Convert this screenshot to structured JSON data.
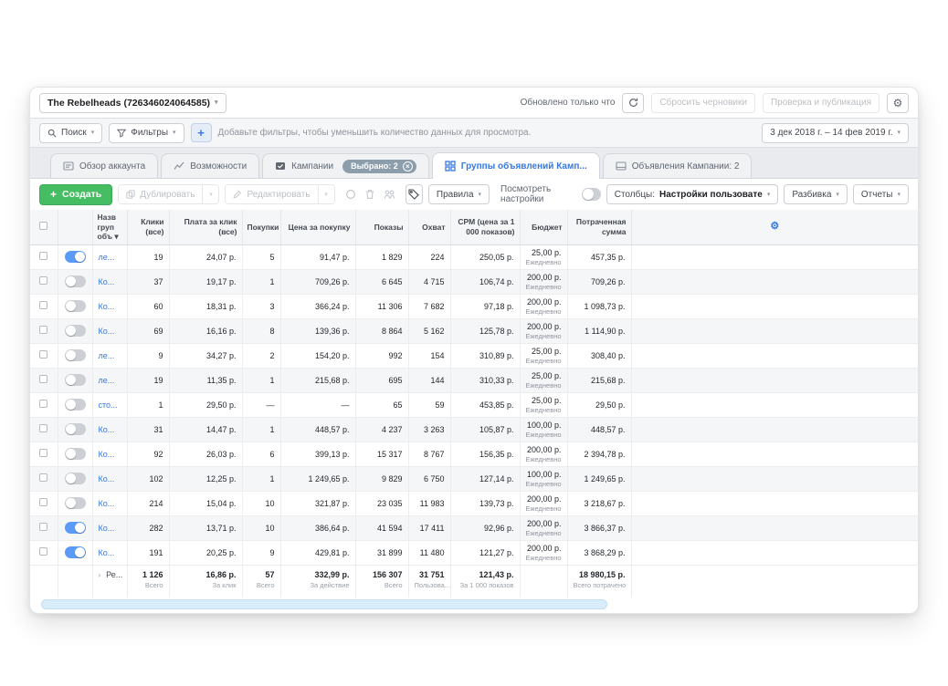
{
  "topbar": {
    "account": "The Rebelheads (726346024064585)",
    "updated": "Обновлено только что",
    "discard_drafts": "Сбросить черновики",
    "review_publish": "Проверка и публикация"
  },
  "filterbar": {
    "search": "Поиск",
    "filters": "Фильтры",
    "placeholder": "Добавьте фильтры, чтобы уменьшить количество данных для просмотра.",
    "date_range": "3 дек 2018 г. – 14 фев 2019 г."
  },
  "tabs": [
    {
      "label": "Обзор аккаунта"
    },
    {
      "label": "Возможности"
    },
    {
      "label": "Кампании",
      "badge": "Выбрано: 2"
    },
    {
      "label": "Группы объявлений Камп..."
    },
    {
      "label": "Объявления Кампании: 2"
    }
  ],
  "toolbar": {
    "create": "Создать",
    "duplicate": "Дублировать",
    "edit": "Редактировать",
    "rules": "Правила",
    "view_settings": "Посмотреть настройки",
    "columns_prefix": "Столбцы:",
    "columns_value": "Настройки пользовате",
    "breakdown": "Разбивка",
    "reports": "Отчеты"
  },
  "table": {
    "columns": [
      "Назв груп объ ▾",
      "Клики (все)",
      "Плата за клик (все)",
      "Покупки",
      "Цена за покупку",
      "Показы",
      "Охват",
      "CPM (цена за 1 000 показов)",
      "Бюджет",
      "Потраченная сумма"
    ],
    "rows": [
      {
        "name": "ле...",
        "on": true,
        "clicks": "19",
        "cpc": "24,07 р.",
        "purchases": "5",
        "cpp": "91,47 р.",
        "impr": "1 829",
        "reach": "224",
        "cpm": "250,05 р.",
        "budget": "25,00 р.",
        "budget_note": "Ежедневно",
        "spent": "457,35 р."
      },
      {
        "name": "Ко...",
        "on": false,
        "clicks": "37",
        "cpc": "19,17 р.",
        "purchases": "1",
        "cpp": "709,26 р.",
        "impr": "6 645",
        "reach": "4 715",
        "cpm": "106,74 р.",
        "budget": "200,00 р.",
        "budget_note": "Ежедневно",
        "spent": "709,26 р."
      },
      {
        "name": "Ко...",
        "on": false,
        "clicks": "60",
        "cpc": "18,31 р.",
        "purchases": "3",
        "cpp": "366,24 р.",
        "impr": "11 306",
        "reach": "7 682",
        "cpm": "97,18 р.",
        "budget": "200,00 р.",
        "budget_note": "Ежедневно",
        "spent": "1 098,73 р."
      },
      {
        "name": "Ко...",
        "on": false,
        "clicks": "69",
        "cpc": "16,16 р.",
        "purchases": "8",
        "cpp": "139,36 р.",
        "impr": "8 864",
        "reach": "5 162",
        "cpm": "125,78 р.",
        "budget": "200,00 р.",
        "budget_note": "Ежедневно",
        "spent": "1 114,90 р."
      },
      {
        "name": "ле...",
        "on": false,
        "clicks": "9",
        "cpc": "34,27 р.",
        "purchases": "2",
        "cpp": "154,20 р.",
        "impr": "992",
        "reach": "154",
        "cpm": "310,89 р.",
        "budget": "25,00 р.",
        "budget_note": "Ежедневно",
        "spent": "308,40 р."
      },
      {
        "name": "ле...",
        "on": false,
        "clicks": "19",
        "cpc": "11,35 р.",
        "purchases": "1",
        "cpp": "215,68 р.",
        "impr": "695",
        "reach": "144",
        "cpm": "310,33 р.",
        "budget": "25,00 р.",
        "budget_note": "Ежедневно",
        "spent": "215,68 р."
      },
      {
        "name": "сто...",
        "on": false,
        "clicks": "1",
        "cpc": "29,50 р.",
        "purchases": "—",
        "cpp": "—",
        "impr": "65",
        "reach": "59",
        "cpm": "453,85 р.",
        "budget": "25,00 р.",
        "budget_note": "Ежедневно",
        "spent": "29,50 р."
      },
      {
        "name": "Ко...",
        "on": false,
        "clicks": "31",
        "cpc": "14,47 р.",
        "purchases": "1",
        "cpp": "448,57 р.",
        "impr": "4 237",
        "reach": "3 263",
        "cpm": "105,87 р.",
        "budget": "100,00 р.",
        "budget_note": "Ежедневно",
        "spent": "448,57 р."
      },
      {
        "name": "Ко...",
        "on": false,
        "clicks": "92",
        "cpc": "26,03 р.",
        "purchases": "6",
        "cpp": "399,13 р.",
        "impr": "15 317",
        "reach": "8 767",
        "cpm": "156,35 р.",
        "budget": "200,00 р.",
        "budget_note": "Ежедневно",
        "spent": "2 394,78 р."
      },
      {
        "name": "Ко...",
        "on": false,
        "clicks": "102",
        "cpc": "12,25 р.",
        "purchases": "1",
        "cpp": "1 249,65 р.",
        "impr": "9 829",
        "reach": "6 750",
        "cpm": "127,14 р.",
        "budget": "100,00 р.",
        "budget_note": "Ежедневно",
        "spent": "1 249,65 р."
      },
      {
        "name": "Ко...",
        "on": false,
        "clicks": "214",
        "cpc": "15,04 р.",
        "purchases": "10",
        "cpp": "321,87 р.",
        "impr": "23 035",
        "reach": "11 983",
        "cpm": "139,73 р.",
        "budget": "200,00 р.",
        "budget_note": "Ежедневно",
        "spent": "3 218,67 р."
      },
      {
        "name": "Ко...",
        "on": true,
        "clicks": "282",
        "cpc": "13,71 р.",
        "purchases": "10",
        "cpp": "386,64 р.",
        "impr": "41 594",
        "reach": "17 411",
        "cpm": "92,96 р.",
        "budget": "200,00 р.",
        "budget_note": "Ежедневно",
        "spent": "3 866,37 р."
      },
      {
        "name": "Ко...",
        "on": true,
        "clicks": "191",
        "cpc": "20,25 р.",
        "purchases": "9",
        "cpp": "429,81 р.",
        "impr": "31 899",
        "reach": "11 480",
        "cpm": "121,27 р.",
        "budget": "200,00 р.",
        "budget_note": "Ежедневно",
        "spent": "3 868,29 р."
      }
    ],
    "totals": {
      "expander": "›",
      "label": "Ре...",
      "cells": [
        {
          "v": "1 126",
          "n": "Всего"
        },
        {
          "v": "16,86 р.",
          "n": "За клик"
        },
        {
          "v": "57",
          "n": "Всего"
        },
        {
          "v": "332,99 р.",
          "n": "За действие"
        },
        {
          "v": "156 307",
          "n": "Всего"
        },
        {
          "v": "31 751",
          "n": "Пользова..."
        },
        {
          "v": "121,43 р.",
          "n": "За 1 000 показов"
        },
        {
          "v": "",
          "n": ""
        },
        {
          "v": "18 980,15 р.",
          "n": "Всего потрачено"
        }
      ]
    }
  },
  "colors": {
    "accent_blue": "#3578e5",
    "create_green": "#45bd62",
    "toggle_on": "#5b9bf8",
    "badge_gray": "#8c9dab",
    "scroll_thumb_blue": "#d9ecf9"
  }
}
